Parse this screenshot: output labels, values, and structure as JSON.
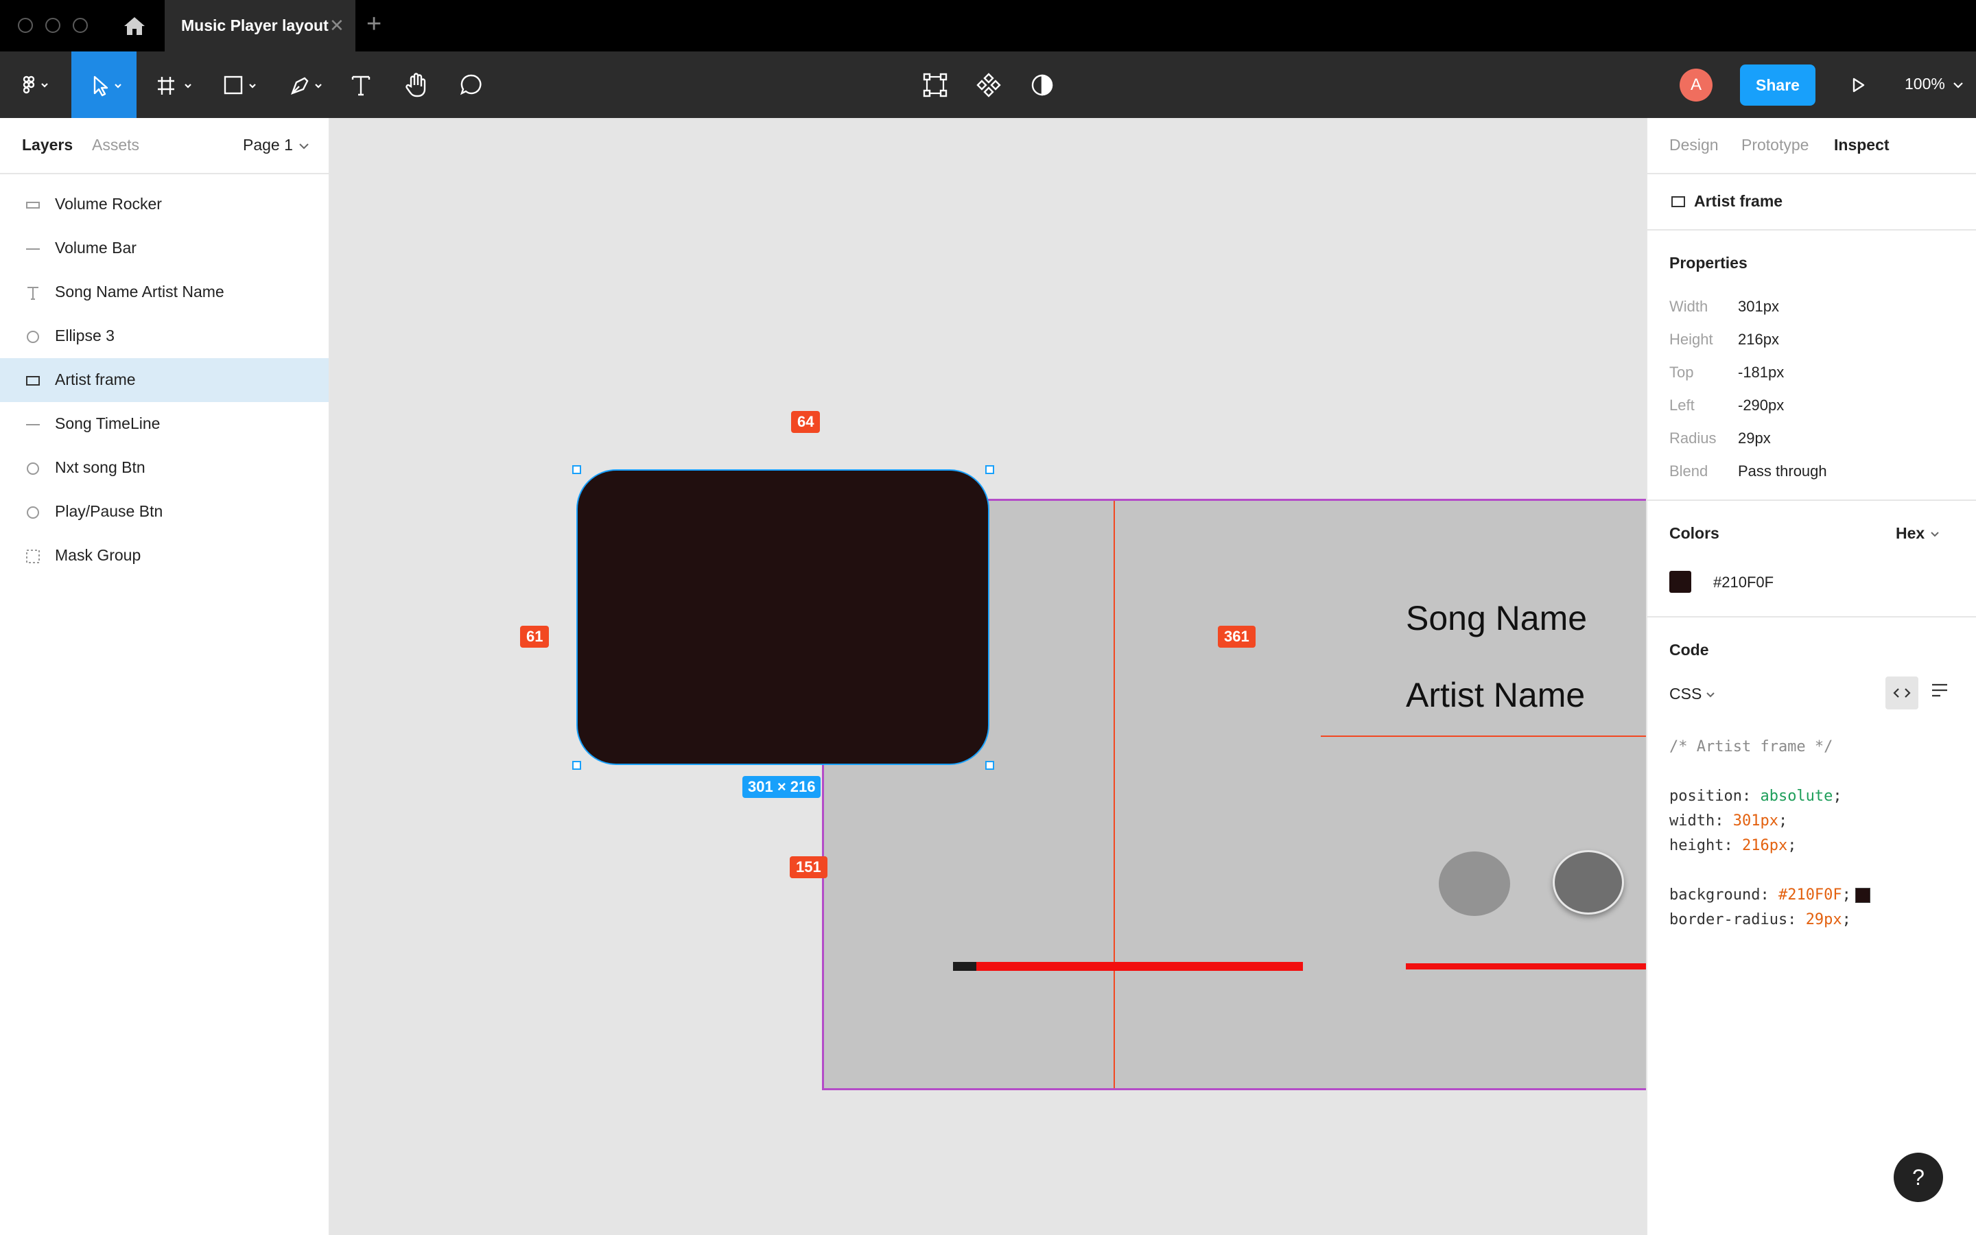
{
  "titlebar": {
    "tab_title": "Music Player layout",
    "close_glyph": "✕",
    "new_tab_glyph": "+",
    "icons": [
      "window-close-icon",
      "window-minimize-icon",
      "window-maximize-icon",
      "home-icon"
    ]
  },
  "toolbar": {
    "tools": [
      "main-menu",
      "move-tool",
      "frame-tool",
      "shape-tool",
      "pen-tool",
      "text-tool",
      "hand-tool",
      "comment-tool"
    ],
    "center_tools": [
      "edit-object-icon",
      "component-icon",
      "mask-contrast-icon"
    ],
    "avatar_initial": "A",
    "share_label": "Share",
    "zoom": "100%"
  },
  "left_panel": {
    "tab_layers": "Layers",
    "tab_assets": "Assets",
    "page": "Page 1",
    "layers": [
      {
        "label": "Volume Rocker",
        "icon": "rectangle-icon",
        "selected": false
      },
      {
        "label": "Volume Bar",
        "icon": "line-icon",
        "selected": false
      },
      {
        "label": "Song Name Artist Name",
        "icon": "text-icon",
        "selected": false
      },
      {
        "label": "Ellipse 3",
        "icon": "ellipse-icon",
        "selected": false
      },
      {
        "label": "Artist frame",
        "icon": "rectangle-icon",
        "selected": true
      },
      {
        "label": "Song TimeLine",
        "icon": "line-icon",
        "selected": false
      },
      {
        "label": "Nxt song Btn",
        "icon": "ellipse-icon",
        "selected": false
      },
      {
        "label": "Play/Pause Btn",
        "icon": "ellipse-icon",
        "selected": false
      },
      {
        "label": "Mask Group",
        "icon": "mask-group-icon",
        "selected": false
      }
    ]
  },
  "canvas": {
    "song_name": "Song Name",
    "artist_name": "Artist Name",
    "measure_top": "64",
    "measure_left": "61",
    "measure_right": "361",
    "measure_bottom": "151",
    "size_badge": "301 × 216",
    "timeline_progress": 0.067,
    "artist_frame_color": "#210F0F",
    "frame_color": "#C4C4C4",
    "guide_color": "#F24822",
    "selection_color": "#18A0FB"
  },
  "right_panel": {
    "tabs": [
      "Design",
      "Prototype",
      "Inspect"
    ],
    "active_tab": "Inspect",
    "selected_layer": "Artist frame",
    "properties_heading": "Properties",
    "properties": [
      {
        "key": "Width",
        "value": "301px"
      },
      {
        "key": "Height",
        "value": "216px"
      },
      {
        "key": "Top",
        "value": "-181px"
      },
      {
        "key": "Left",
        "value": "-290px"
      },
      {
        "key": "Radius",
        "value": "29px"
      },
      {
        "key": "Blend",
        "value": "Pass through"
      }
    ],
    "colors_heading": "Colors",
    "color_format": "Hex",
    "color_value": "#210F0F",
    "code_heading": "Code",
    "code_language": "CSS",
    "code": {
      "comment": "/* Artist frame */",
      "position_key": "position: ",
      "position_val": "absolute",
      "width_key": "width: ",
      "width_val": "301px",
      "height_key": "height: ",
      "height_val": "216px",
      "background_key": "background: ",
      "background_val": "#210F0F",
      "radius_key": "border-radius: ",
      "radius_val": "29px",
      "semicolon": ";"
    }
  },
  "help_label": "?"
}
